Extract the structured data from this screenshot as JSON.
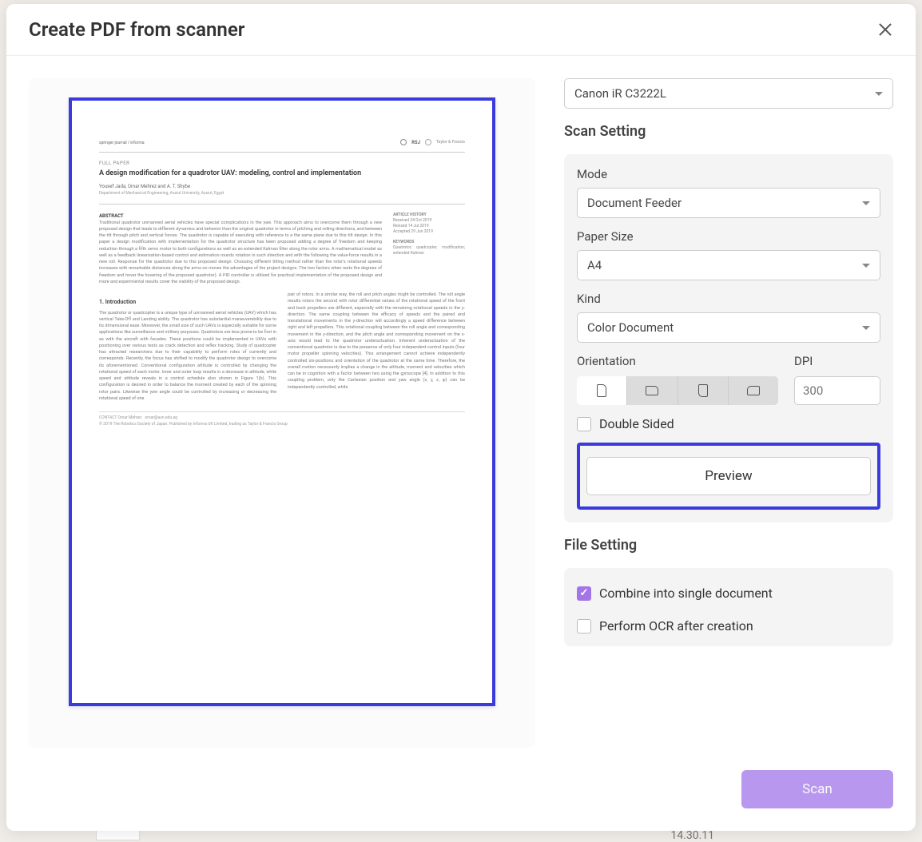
{
  "dialog": {
    "title": "Create PDF from scanner"
  },
  "scanner": {
    "selected": "Canon iR C3222L"
  },
  "scan_setting": {
    "label": "Scan Setting",
    "mode": {
      "label": "Mode",
      "value": "Document Feeder"
    },
    "paper_size": {
      "label": "Paper Size",
      "value": "A4"
    },
    "kind": {
      "label": "Kind",
      "value": "Color Document"
    },
    "orientation": {
      "label": "Orientation"
    },
    "dpi": {
      "label": "DPI",
      "placeholder": "300"
    },
    "double_sided": {
      "label": "Double Sided",
      "checked": false
    },
    "preview_button": "Preview"
  },
  "file_setting": {
    "label": "File Setting",
    "combine": {
      "label": "Combine into single document",
      "checked": true
    },
    "ocr": {
      "label": "Perform OCR after creation",
      "checked": false
    }
  },
  "actions": {
    "scan": "Scan"
  },
  "preview_doc": {
    "tag": "FULL PAPER",
    "title": "A design modification for a quadrotor UAV: modeling, control and implementation",
    "authors": "Yousef Jada, Omar Mehrez and A. T. Shybe",
    "affil": "Department of Mechanical Engineering, Assiut University, Assiut, Egypt",
    "abstract_label": "ABSTRACT",
    "article_meta_label": "ARTICLE HISTORY",
    "section_intro": "1. Introduction",
    "logo": "RSJ"
  },
  "background": {
    "time": "14.30.11"
  }
}
